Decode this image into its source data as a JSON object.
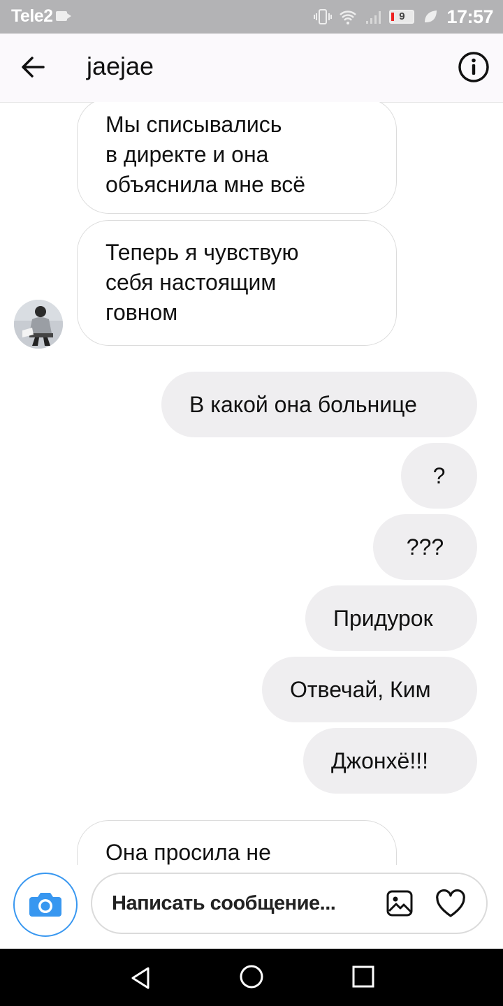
{
  "status_bar": {
    "carrier": "Tele2",
    "battery": "9",
    "time": "17:57"
  },
  "header": {
    "title": "jaejae"
  },
  "messages": [
    {
      "from": "other",
      "text": "Мы списывались\nв директе и она\nобъяснила мне всё"
    },
    {
      "from": "other",
      "text": "Теперь я чувствую\nсебя настоящим\nговном"
    },
    {
      "from": "me",
      "text": "В какой она больнице"
    },
    {
      "from": "me",
      "text": "?"
    },
    {
      "from": "me",
      "text": "???"
    },
    {
      "from": "me",
      "text": "Придурок"
    },
    {
      "from": "me",
      "text": "Отвечай, Ким"
    },
    {
      "from": "me",
      "text": "Джонхё!!!"
    },
    {
      "from": "other",
      "text": "Она просила не"
    }
  ],
  "composer": {
    "placeholder": "Написать сообщение..."
  },
  "colors": {
    "accent": "#3897f0",
    "outgoing_bubble": "#efeef0",
    "incoming_border": "#dcdcdc",
    "status_bar": "#b3b3b5"
  },
  "icons": {
    "back": "arrow-left-icon",
    "info": "info-icon",
    "camera": "camera-icon",
    "gallery": "image-icon",
    "like": "heart-icon"
  }
}
